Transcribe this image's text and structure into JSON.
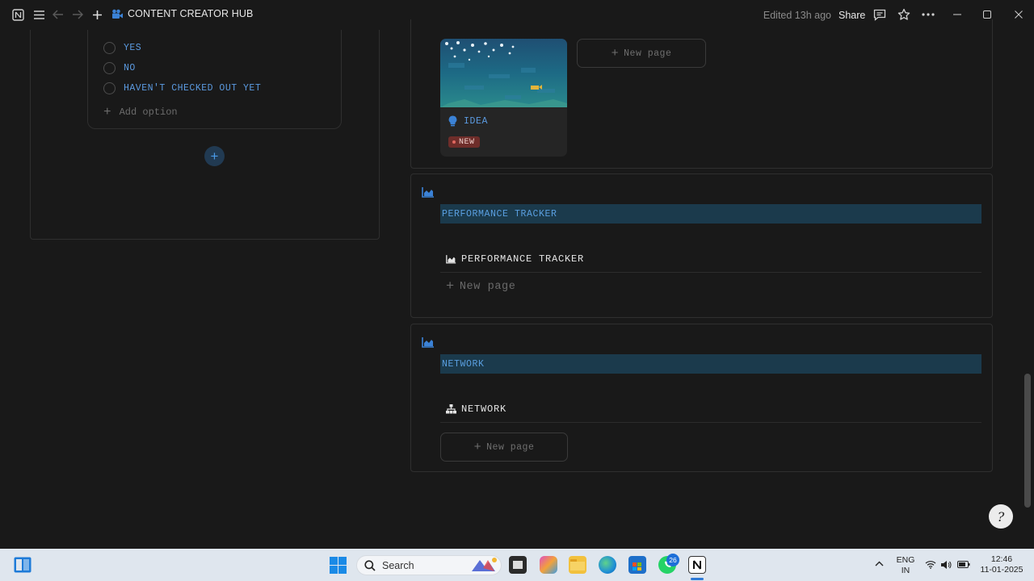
{
  "topbar": {
    "title": "CONTENT CREATOR HUB",
    "edited": "Edited 13h ago",
    "share_label": "Share"
  },
  "options_panel": {
    "options": [
      "YES",
      "NO",
      "HAVEN'T CHECKED OUT YET"
    ],
    "add_option": "Add option"
  },
  "gallery": {
    "card_title": "IDEA",
    "badge": "NEW",
    "new_page": "New page"
  },
  "performance": {
    "highlight_title": "PERFORMANCE TRACKER",
    "db_title": "PERFORMANCE TRACKER",
    "new_page": "New page"
  },
  "network": {
    "highlight_title": "NETWORK",
    "db_title": "NETWORK",
    "new_page": "New page"
  },
  "taskbar": {
    "search_placeholder": "Search",
    "lang_top": "ENG",
    "lang_bottom": "IN",
    "time": "12:46",
    "date": "11-01-2025",
    "whatsapp_badge": "26"
  },
  "colors": {
    "accent_blue": "#5b9ae0",
    "highlight_bg": "#1b3a4c",
    "badge_bg": "#6e2d2a",
    "page_bg": "#191919"
  }
}
